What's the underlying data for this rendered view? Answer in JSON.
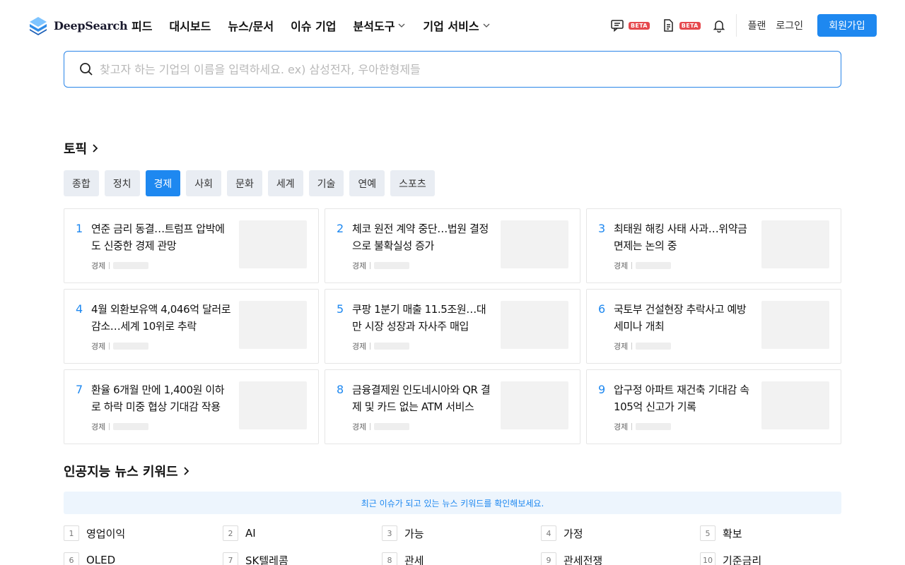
{
  "header": {
    "logo_text": "DeepSearch",
    "nav": [
      {
        "label": "피드",
        "dropdown": false
      },
      {
        "label": "대시보드",
        "dropdown": false
      },
      {
        "label": "뉴스/문서",
        "dropdown": false
      },
      {
        "label": "이슈 기업",
        "dropdown": false
      },
      {
        "label": "분석도구",
        "dropdown": true
      },
      {
        "label": "기업 서비스",
        "dropdown": true
      }
    ],
    "beta_label": "BETA",
    "plan_label": "플랜",
    "login_label": "로그인",
    "signup_label": "회원가입"
  },
  "search": {
    "placeholder": "찾고자 하는 기업의 이름을 입력하세요. ex) 삼성전자, 우아한형제들"
  },
  "topics": {
    "title": "토픽",
    "tabs": [
      "종합",
      "정치",
      "경제",
      "사회",
      "문화",
      "세계",
      "기술",
      "연예",
      "스포츠"
    ],
    "active_tab": "경제",
    "news": [
      {
        "rank": "1",
        "title": "연준 금리 동결…트럼프 압박에도 신중한 경제 관망",
        "category": "경제"
      },
      {
        "rank": "2",
        "title": "체코 원전 계약 중단…법원 결정으로 불확실성 증가",
        "category": "경제"
      },
      {
        "rank": "3",
        "title": "최태원 해킹 사태 사과…위약금 면제는 논의 중",
        "category": "경제"
      },
      {
        "rank": "4",
        "title": "4월 외환보유액 4,046억 달러로 감소…세계 10위로 추락",
        "category": "경제"
      },
      {
        "rank": "5",
        "title": "쿠팡 1분기 매출 11.5조원…대만 시장 성장과 자사주 매입",
        "category": "경제"
      },
      {
        "rank": "6",
        "title": "국토부 건설현장 추락사고 예방 세미나 개최",
        "category": "경제"
      },
      {
        "rank": "7",
        "title": "환율 6개월 만에 1,400원 이하로 하락 미중 협상 기대감 작용",
        "category": "경제"
      },
      {
        "rank": "8",
        "title": "금융결제원 인도네시아와 QR 결제 및 카드 없는 ATM 서비스",
        "category": "경제"
      },
      {
        "rank": "9",
        "title": "압구정 아파트 재건축 기대감 속 105억 신고가 기록",
        "category": "경제"
      }
    ]
  },
  "keywords": {
    "title": "인공지능 뉴스 키워드",
    "banner": "최근 이슈가 되고 있는 뉴스 키워드를 확인해보세요.",
    "items": [
      {
        "rank": "1",
        "label": "영업이익"
      },
      {
        "rank": "2",
        "label": "AI"
      },
      {
        "rank": "3",
        "label": "가능"
      },
      {
        "rank": "4",
        "label": "가정"
      },
      {
        "rank": "5",
        "label": "확보"
      },
      {
        "rank": "6",
        "label": "OLED"
      },
      {
        "rank": "7",
        "label": "SK텔레콤"
      },
      {
        "rank": "8",
        "label": "관세"
      },
      {
        "rank": "9",
        "label": "관세전쟁"
      },
      {
        "rank": "10",
        "label": "기준금리"
      }
    ]
  },
  "colors": {
    "accent": "#1e88f0",
    "beta_badge": "#e5484d",
    "tab_bg": "#e9edf3",
    "banner_bg": "#edf5fd"
  },
  "icons": {
    "chat": "chat-icon",
    "document": "document-icon",
    "bell": "bell-icon",
    "search": "search-icon"
  }
}
